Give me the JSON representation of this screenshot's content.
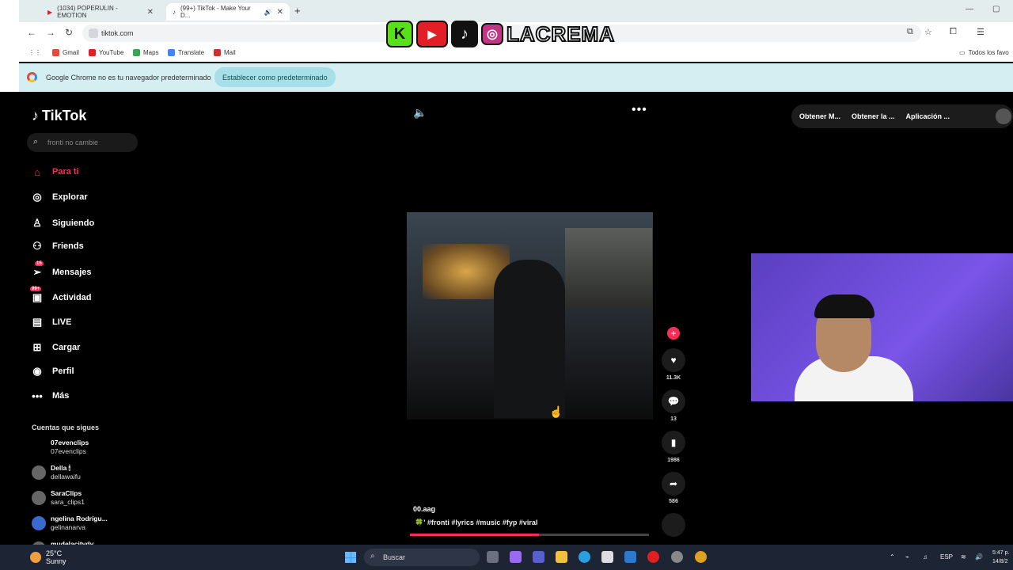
{
  "browser": {
    "tabs": [
      {
        "label": "(1034) POPERULIN - EMOTION"
      },
      {
        "label": "(99+) TikTok - Make Your D..."
      }
    ],
    "new_tab": "+",
    "url": "tiktok.com",
    "bookmarks": [
      "Gmail",
      "YouTube",
      "Maps",
      "Translate",
      "Mail"
    ],
    "all_bookmarks": "Todos los favo",
    "infobar": {
      "message": "Google Chrome no es tu navegador predeterminado",
      "button": "Establecer como predeterminado"
    }
  },
  "overlay": {
    "k": "K",
    "tt": "♪",
    "ig": "◎",
    "text": "LACREMA"
  },
  "tiktok": {
    "logo": "TikTok",
    "search_placeholder": "fronti no cambie",
    "nav": [
      {
        "label": "Para ti",
        "icon": "home-icon"
      },
      {
        "label": "Explorar",
        "icon": "compass-icon"
      },
      {
        "label": "Siguiendo",
        "icon": "following-icon"
      },
      {
        "label": "Friends",
        "icon": "friends-icon"
      },
      {
        "label": "Mensajes",
        "icon": "messages-icon",
        "badge": "15"
      },
      {
        "label": "Actividad",
        "icon": "activity-icon",
        "badge": "99+"
      },
      {
        "label": "LIVE",
        "icon": "live-icon"
      },
      {
        "label": "Cargar",
        "icon": "upload-icon"
      },
      {
        "label": "Perfil",
        "icon": "profile-icon"
      },
      {
        "label": "Más",
        "icon": "more-icon"
      }
    ],
    "following_heading": "Cuentas que sigues",
    "accounts": [
      {
        "name": "07evenclips",
        "handle": "07evenclips"
      },
      {
        "name": "Della 🕯",
        "handle": "dellawaifu"
      },
      {
        "name": "SaraClips",
        "handle": "sara_clips1"
      },
      {
        "name": "ngelina Rodrígu...",
        "handle": "gelinanarva"
      },
      {
        "name": "mudelacitydy",
        "handle": ""
      }
    ],
    "top_buttons": [
      "Obtener M...",
      "Obtener la ...",
      "Aplicación ..."
    ],
    "video": {
      "author": "00.aag",
      "caption": "🍀' #fronti #lyrics #music #fyp #viral",
      "progress_fraction": 0.54
    },
    "rail": {
      "likes": "11.3K",
      "comments": "13",
      "saves": "1986",
      "shares": "586"
    }
  },
  "taskbar": {
    "weather_temp": "25°C",
    "weather_desc": "Sunny",
    "search": "Buscar",
    "lang": "ESP",
    "time": "5:47 p.",
    "date": "14/8/2"
  },
  "colors": {
    "accent": "#fe2c55",
    "infobar": "#d5eef1"
  }
}
